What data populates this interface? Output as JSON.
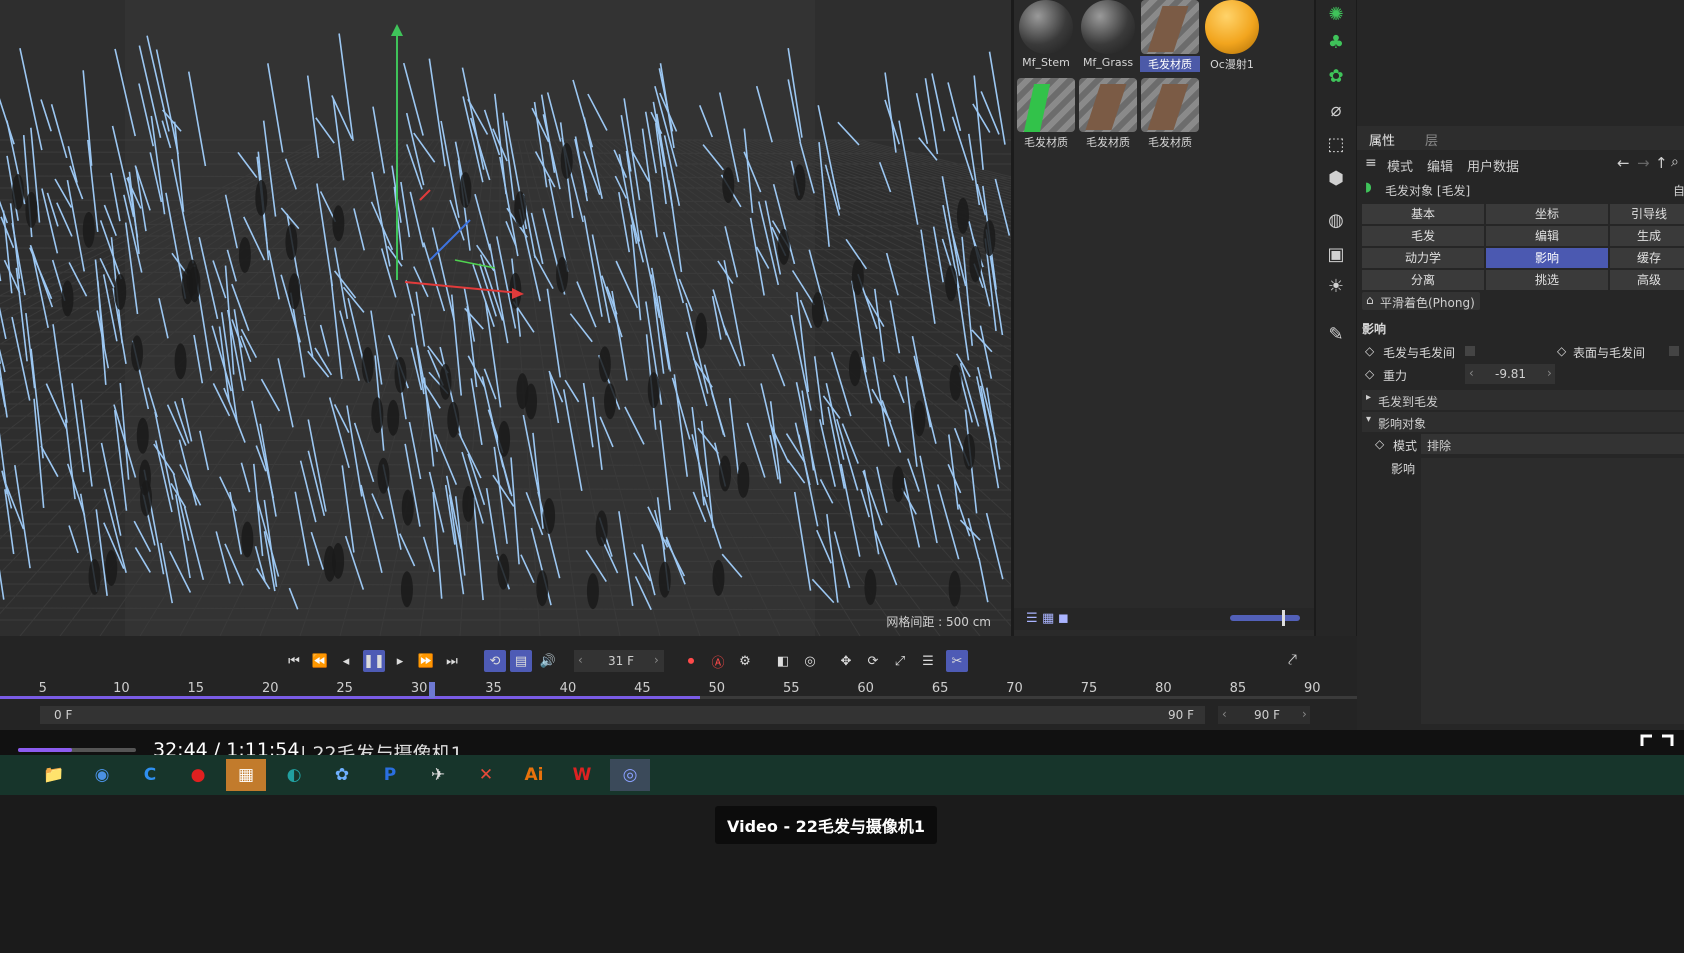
{
  "viewport": {
    "grid_label": "网格间距 : 500 cm"
  },
  "materials": [
    {
      "label": "Mf_Stem",
      "selected": false,
      "swatch": "sphere-dark"
    },
    {
      "label": "Mf_Grass",
      "selected": false,
      "swatch": "sphere-dark"
    },
    {
      "label": "毛发材质",
      "selected": true,
      "swatch": "hair-brown"
    },
    {
      "label": "Oc漫射1",
      "selected": false,
      "swatch": "sphere-orange"
    },
    {
      "label": "毛发材质",
      "selected": false,
      "swatch": "hair-green"
    },
    {
      "label": "毛发材质",
      "selected": false,
      "swatch": "hair-brown"
    },
    {
      "label": "毛发材质",
      "selected": false,
      "swatch": "hair-brown"
    }
  ],
  "tools": [
    "light-icon",
    "cloner-icon",
    "gear-icon",
    "deformer-icon",
    "spline-icon",
    "effector-icon",
    "globe-icon",
    "camera-icon",
    "bulb-icon",
    "edit-icon"
  ],
  "attributes": {
    "tabs": [
      "属性",
      "层"
    ],
    "menu": [
      "模式",
      "编辑",
      "用户数据"
    ],
    "object_title": "毛发对象 [毛发]",
    "object_suffix": "自",
    "grid": [
      [
        "基本",
        "坐标",
        "引导线"
      ],
      [
        "毛发",
        "编辑",
        "生成"
      ],
      [
        "动力学",
        "影响",
        "缓存"
      ],
      [
        "分离",
        "挑选",
        "高级"
      ]
    ],
    "active_tab": "影响",
    "smooth_shading": "平滑着色(Phong)",
    "section": "影响",
    "hair_to_hair": "毛发与毛发间",
    "surface_to_hair": "表面与毛发间",
    "gravity_label": "重力",
    "gravity_value": "-9.81",
    "hair_to_hair_group": "毛发到毛发",
    "influence_objects": "影响对象",
    "mode_label": "模式",
    "mode_value": "排除",
    "influence_label": "影响"
  },
  "timeline": {
    "current_frame": "31 F",
    "start_frame": "0 F",
    "end_frame": "90 F",
    "max_frame": "90 F",
    "ruler": [
      "5",
      "10",
      "15",
      "20",
      "25",
      "30",
      "35",
      "40",
      "45",
      "50",
      "55",
      "60",
      "65",
      "70",
      "75",
      "80",
      "85",
      "90"
    ],
    "ruler_min": 2,
    "ruler_max": 90,
    "playhead_frame": 31,
    "preview_end_frame": 49
  },
  "video": {
    "time": "32:44 / 1:11:54",
    "title": "| 22毛发与摄像机1",
    "progress": 0.46,
    "tooltip": "Video - 22毛发与摄像机1"
  },
  "taskbar": [
    "file-explorer-icon",
    "chrome-icon",
    "edge-c-icon",
    "record-icon",
    "app-icon",
    "edge-icon",
    "cloud-icon",
    "p-app-icon",
    "feishu-icon",
    "x-app-icon",
    "illustrator-icon",
    "wps-icon",
    "c4d-icon"
  ],
  "taskbar_glyphs": [
    "📁",
    "◉",
    "C",
    "●",
    "▦",
    "◐",
    "✿",
    "P",
    "✈",
    "✕",
    "Ai",
    "W",
    "◎"
  ],
  "colors": {
    "accent": "#4e5bb5",
    "hair": "#9cc7f2",
    "taskbar": "#17352b"
  }
}
